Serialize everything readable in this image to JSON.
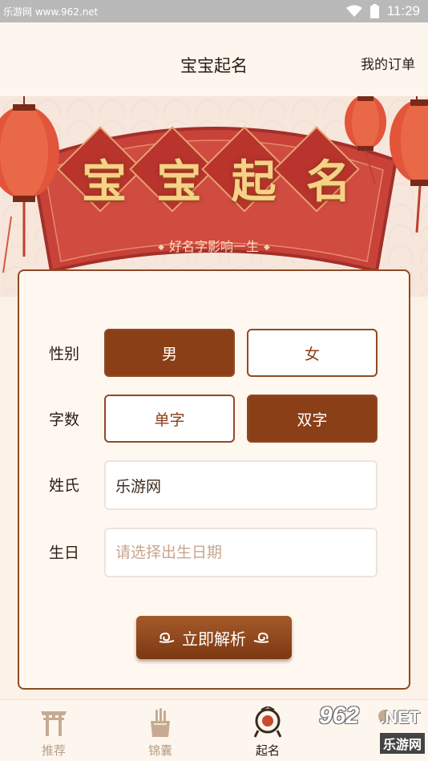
{
  "status_bar": {
    "watermark": "乐游网 www.962.net",
    "time": "11:29"
  },
  "header": {
    "title": "宝宝起名",
    "orders_link": "我的订单"
  },
  "banner": {
    "title_chars": [
      "宝",
      "宝",
      "起",
      "名"
    ],
    "slogan": "好名字影响一生",
    "colors": {
      "fan": "#c8423a",
      "gold": "#f5d287",
      "diamond": "#b8342d"
    }
  },
  "form": {
    "gender": {
      "label": "性别",
      "options": [
        "男",
        "女"
      ],
      "selected": "男"
    },
    "char_count": {
      "label": "字数",
      "options": [
        "单字",
        "双字"
      ],
      "selected": "双字"
    },
    "surname": {
      "label": "姓氏",
      "value": "乐游网"
    },
    "birthday": {
      "label": "生日",
      "placeholder": "请选择出生日期"
    },
    "submit_label": "立即解析"
  },
  "tabs": [
    {
      "label": "推荐",
      "icon": "torii-gate-icon",
      "active": false
    },
    {
      "label": "锦囊",
      "icon": "scroll-pouch-icon",
      "active": false
    },
    {
      "label": "起名",
      "icon": "name-compass-icon",
      "active": true
    },
    {
      "label": "",
      "icon": "profile-icon",
      "active": false
    }
  ],
  "watermark_badge": {
    "brand": "962",
    "suffix": ".NET",
    "site": "乐游网"
  },
  "colors": {
    "accent": "#8b3f17",
    "background": "#fbf1e6",
    "card_border": "#8f4a24"
  }
}
